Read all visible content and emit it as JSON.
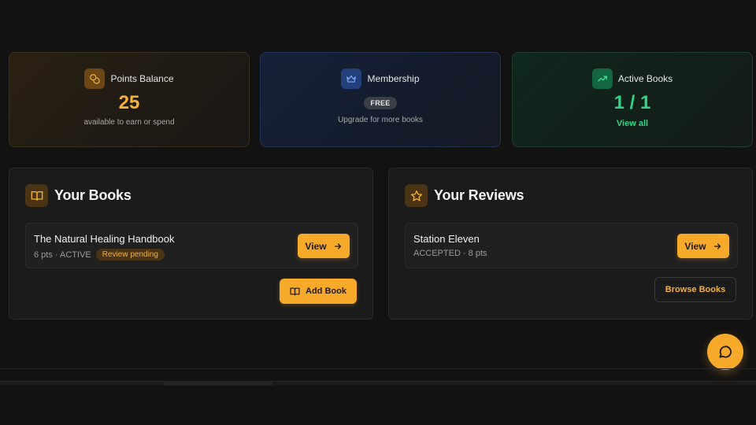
{
  "stats": {
    "points": {
      "label": "Points Balance",
      "value": "25",
      "sub": "available to earn or spend",
      "icon": "coins-icon"
    },
    "membership": {
      "label": "Membership",
      "badge": "FREE",
      "sub": "Upgrade for more books",
      "icon": "crown-icon"
    },
    "active": {
      "label": "Active Books",
      "value": "1 / 1",
      "link": "View all",
      "icon": "trending-up-icon"
    }
  },
  "books_panel": {
    "title": "Your Books",
    "icon": "book-open-icon",
    "items": [
      {
        "title": "The Natural Healing Handbook",
        "meta": "6 pts · ACTIVE",
        "badge": "Review pending",
        "action": "View"
      }
    ],
    "add_button": "Add Book"
  },
  "reviews_panel": {
    "title": "Your Reviews",
    "icon": "star-icon",
    "items": [
      {
        "title": "Station Eleven",
        "meta": "ACCEPTED · 8 pts",
        "action": "View"
      }
    ],
    "browse_button": "Browse Books"
  },
  "chat": {
    "icon": "chat-bubble-icon"
  },
  "colors": {
    "accent": "#f7a92a",
    "success": "#2fd48a",
    "background": "#121212"
  }
}
